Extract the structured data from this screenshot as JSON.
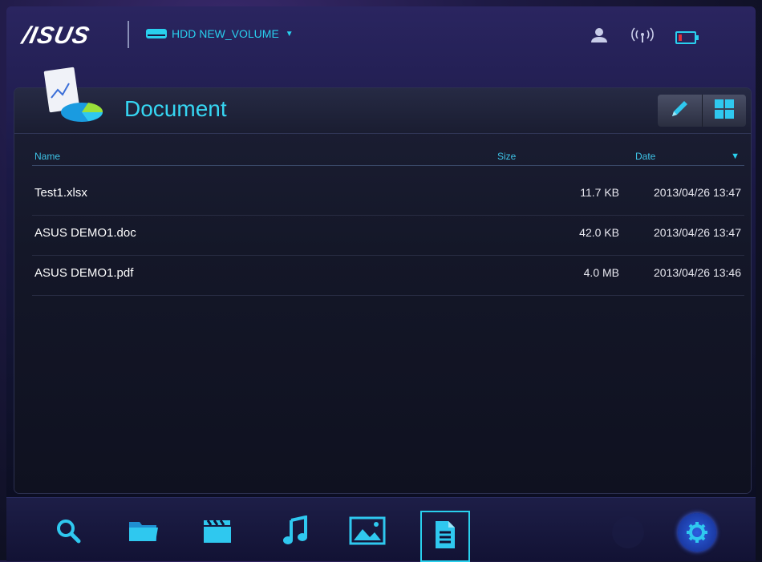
{
  "header": {
    "logo": "/ISUS",
    "volume_label": "HDD NEW_VOLUME",
    "volume_caret": "▼",
    "status_icons": [
      "user-icon",
      "wireless-icon",
      "battery-icon"
    ]
  },
  "panel": {
    "title": "Document",
    "tools": [
      "edit-icon",
      "grid-view-icon"
    ]
  },
  "table": {
    "columns": {
      "name": "Name",
      "size": "Size",
      "date": "Date"
    },
    "sort_indicator": "▼",
    "rows": [
      {
        "name": "Test1.xlsx",
        "size": "11.7 KB",
        "date": "2013/04/26 13:47"
      },
      {
        "name": "ASUS DEMO1.doc",
        "size": "42.0 KB",
        "date": "2013/04/26 13:47"
      },
      {
        "name": "ASUS DEMO1.pdf",
        "size": "4.0 MB",
        "date": "2013/04/26 13:46"
      }
    ]
  },
  "bottom_nav": {
    "items": [
      "search-icon",
      "folder-icon",
      "video-icon",
      "music-icon",
      "photo-icon",
      "document-icon",
      "dim-icon",
      "settings-icon"
    ],
    "active": "document-icon"
  },
  "colors": {
    "accent": "#29d0ee",
    "title": "#36d6f2",
    "battery_low": "#e0303a"
  }
}
